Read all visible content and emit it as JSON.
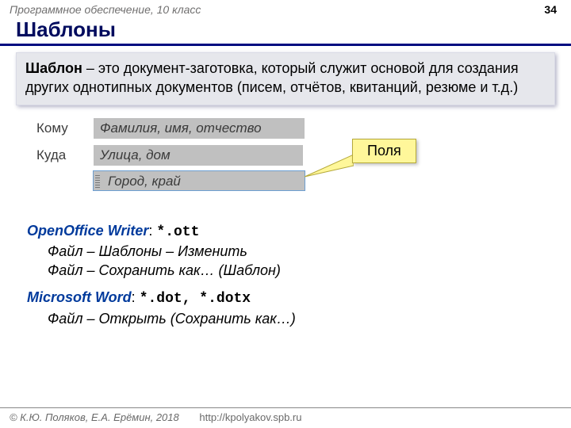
{
  "header": {
    "course": "Программное обеспечение, 10 класс",
    "page": "34"
  },
  "title": "Шаблоны",
  "definition": {
    "term": "Шаблон",
    "rest": " – это документ-заготовка, который служит основой для создания других однотипных документов (писем, отчётов, квитанций, резюме и т.д.)"
  },
  "form": {
    "row1": {
      "label": "Кому",
      "value": "Фамилия, имя, отчество"
    },
    "row2": {
      "label": "Куда",
      "value": "Улица, дом"
    },
    "row3": {
      "value": "Город, край"
    },
    "callout": "Поля"
  },
  "openoffice": {
    "app": "OpenOffice Writer",
    "ext": "*.ott",
    "line1": "Файл – Шаблоны – Изменить",
    "line2": "Файл – Сохранить как… (Шаблон)"
  },
  "msword": {
    "app": "Microsoft Word",
    "ext": "*.dot, *.dotx",
    "line1": "Файл – Открыть (Сохранить как…)"
  },
  "footer": {
    "copy": "© К.Ю. Поляков, Е.А. Ерёмин, 2018",
    "url": "http://kpolyakov.spb.ru"
  }
}
